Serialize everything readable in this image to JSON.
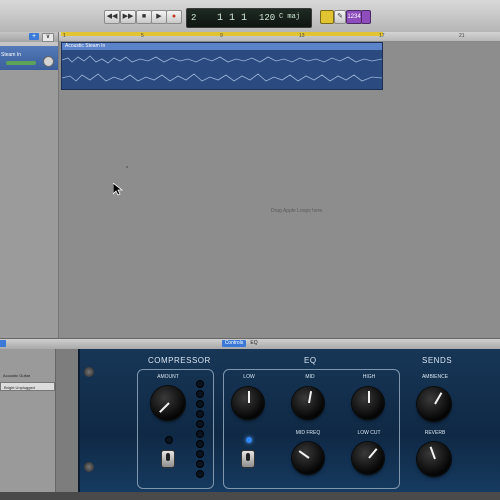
{
  "transport": {
    "lcd_bar": "2",
    "lcd_position": "1 1 1",
    "lcd_tempo": "120",
    "lcd_key": "C maj",
    "buttons": [
      "rewind",
      "fast-forward",
      "stop",
      "play",
      "record"
    ],
    "lcd_purple_label": "1234"
  },
  "track": {
    "name": "Steam In",
    "region_title": "Acoustic Steam In"
  },
  "ruler": {
    "ticks": [
      "1",
      "5",
      "9",
      "13",
      "17",
      "21"
    ]
  },
  "arrange": {
    "drop_hint": "Drag Apple Loops here."
  },
  "bottom": {
    "tab_controls": "Controls",
    "tab_eq": "EQ",
    "library": {
      "items": [
        "Acoustic Guitar",
        "Bright Unplugged"
      ]
    }
  },
  "plugin": {
    "sections": {
      "compressor": "COMPRESSOR",
      "eq": "EQ",
      "sends": "SENDS"
    },
    "knobs": {
      "amount": "AMOUNT",
      "low": "LOW",
      "mid": "MID",
      "high": "HIGH",
      "mid_freq": "MID FREQ",
      "low_cut": "LOW CUT",
      "ambience": "AMBIENCE",
      "reverb": "REVERB"
    }
  },
  "colors": {
    "cycle": "#e0c431",
    "region": "#2b4a80",
    "plugin_bg": "#173656",
    "accent_blue": "#3b79d8"
  }
}
